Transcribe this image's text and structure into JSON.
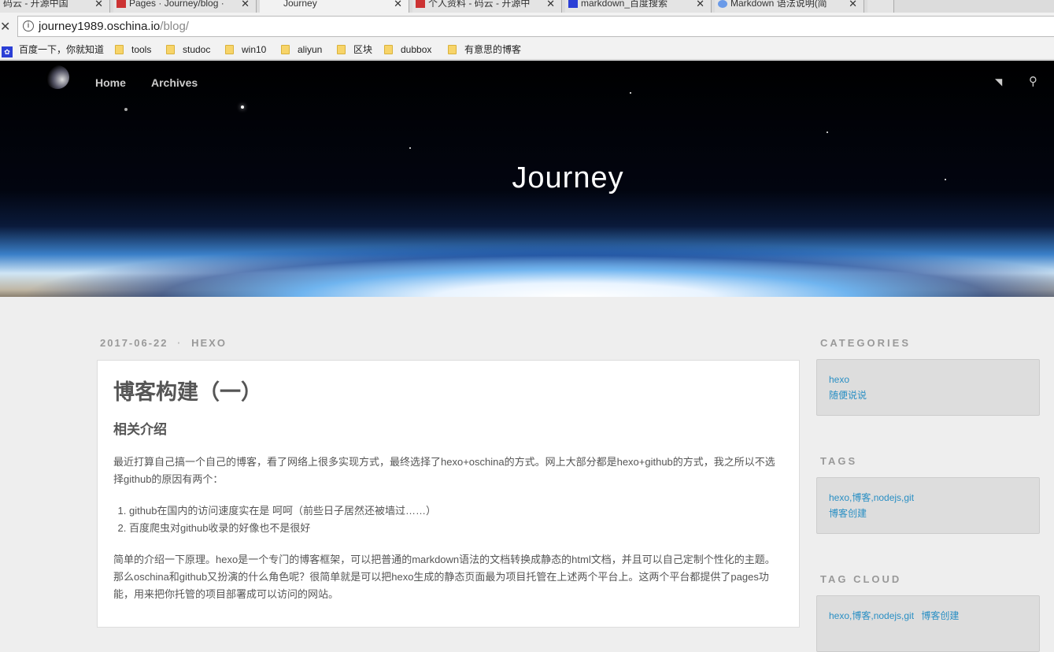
{
  "browser": {
    "tabs": [
      {
        "title": "码云 - 开源中国",
        "active": false
      },
      {
        "title": "Pages · Journey/blog ·",
        "active": false
      },
      {
        "title": "Journey",
        "active": true
      },
      {
        "title": "个人资料 - 码云 - 开源中",
        "active": false
      },
      {
        "title": "markdown_百度搜索",
        "active": false
      },
      {
        "title": "Markdown 语法说明(简",
        "active": false
      }
    ],
    "url_host": "journey1989.oschina.io",
    "url_path": "/blog/",
    "bookmarks": [
      "百度一下，你就知道",
      "tools",
      "studoc",
      "win10",
      "aliyun",
      "区块",
      "dubbox",
      "有意思的博客"
    ]
  },
  "site": {
    "nav": [
      "Home",
      "Archives"
    ],
    "title": "Journey"
  },
  "post": {
    "date": "2017-06-22",
    "sep": "·",
    "category": "HEXO",
    "title": "博客构建（一）",
    "subtitle": "相关介绍",
    "para1": "最近打算自己搞一个自己的博客，看了网络上很多实现方式，最终选择了hexo+oschina的方式。网上大部分都是hexo+github的方式，我之所以不选择github的原因有两个：",
    "list": [
      "github在国内的访问速度实在是 呵呵（前些日子居然还被墙过……）",
      "百度爬虫对github收录的好像也不是很好"
    ],
    "para2": "简单的介绍一下原理。hexo是一个专门的博客框架，可以把普通的markdown语法的文档转换成静态的html文档，并且可以自己定制个性化的主题。那么oschina和github又扮演的什么角色呢？很简单就是可以把hexo生成的静态页面最为项目托管在上述两个平台上。这两个平台都提供了pages功能，用来把你托管的项目部署成可以访问的网站。"
  },
  "sidebar": {
    "categories": {
      "heading": "CATEGORIES",
      "items": [
        "hexo",
        "随便说说"
      ]
    },
    "tags": {
      "heading": "TAGS",
      "items": [
        "hexo,博客,nodejs,git",
        "博客创建"
      ]
    },
    "tag_cloud": {
      "heading": "TAG CLOUD",
      "items": [
        "hexo,博客,nodejs,git",
        "博客创建"
      ]
    }
  },
  "colors": {
    "link": "#2a8fc4",
    "background": "#eeeeee"
  }
}
